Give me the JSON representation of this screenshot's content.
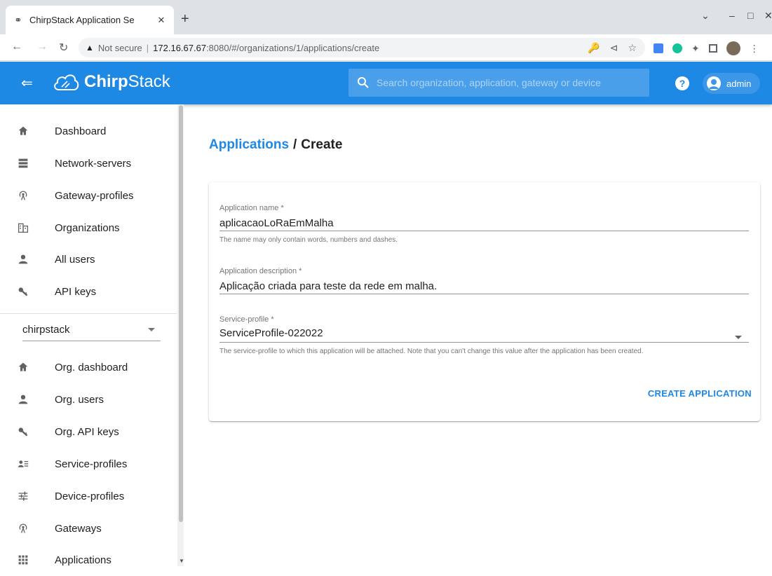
{
  "browser": {
    "tab_title": "ChirpStack Application Se",
    "url_warning": "Not secure",
    "url_host": "172.16.67.67",
    "url_path": ":8080/#/organizations/1/applications/create"
  },
  "header": {
    "brand_bold": "Chirp",
    "brand_regular": "Stack",
    "search_placeholder": "Search organization, application, gateway or device",
    "help_label": "?",
    "user": "admin"
  },
  "sidebar": {
    "global_items": [
      {
        "label": "Dashboard",
        "icon": "home-icon"
      },
      {
        "label": "Network-servers",
        "icon": "server-icon"
      },
      {
        "label": "Gateway-profiles",
        "icon": "radio-tower-icon"
      },
      {
        "label": "Organizations",
        "icon": "domain-icon"
      },
      {
        "label": "All users",
        "icon": "account-icon"
      },
      {
        "label": "API keys",
        "icon": "key-icon"
      }
    ],
    "org_selected": "chirpstack",
    "org_items": [
      {
        "label": "Org. dashboard",
        "icon": "home-icon"
      },
      {
        "label": "Org. users",
        "icon": "account-icon"
      },
      {
        "label": "Org. API keys",
        "icon": "key-icon"
      },
      {
        "label": "Service-profiles",
        "icon": "account-details-icon"
      },
      {
        "label": "Device-profiles",
        "icon": "tune-icon"
      },
      {
        "label": "Gateways",
        "icon": "radio-tower-icon"
      },
      {
        "label": "Applications",
        "icon": "apps-icon"
      }
    ]
  },
  "main": {
    "breadcrumb_link": "Applications",
    "breadcrumb_sep": "/",
    "breadcrumb_current": "Create",
    "form": {
      "name_label": "Application name *",
      "name_value": "aplicacaoLoRaEmMalha",
      "name_help": "The name may only contain words, numbers and dashes.",
      "desc_label": "Application description *",
      "desc_value": "Aplicação criada para teste da rede em malha.",
      "sp_label": "Service-profile *",
      "sp_value": "ServiceProfile-022022",
      "sp_help": "The service-profile to which this application will be attached. Note that you can't change this value after the application has been created.",
      "submit_label": "CREATE APPLICATION"
    }
  },
  "colors": {
    "primary": "#1e88e5",
    "search_bg": "#4a9fea"
  }
}
